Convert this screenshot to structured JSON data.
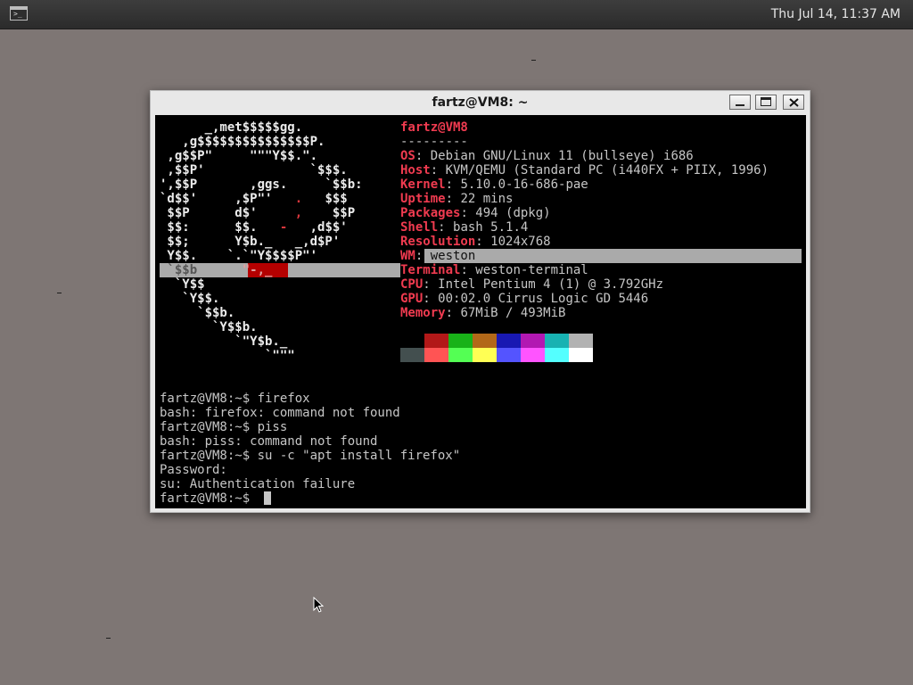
{
  "panel": {
    "clock": "Thu Jul 14, 11:37 AM",
    "launcher_icon": "terminal-icon"
  },
  "window": {
    "title": "fartz@VM8: ~",
    "buttons": [
      "minimize-icon",
      "maximize-icon",
      "close-icon"
    ]
  },
  "logo": {
    "lines": [
      "      _,met$$$$$gg.",
      "   ,g$$$$$$$$$$$$$$$P.",
      " ,g$$P\"     \"\"\"Y$$.\".",
      " ,$$P'              `$$$.",
      "',$$P       ,ggs.     `$$b:",
      "`d$$'     ,$P\"'   ",
      " $$P      d$'     ",
      " $$:      $$.   ",
      " $$;      Y$b._   _,d$P'",
      " Y$$.    `.`\"Y$$$$P\"'",
      " `$$b      ",
      "  `Y$$",
      "   `Y$$.",
      "     `$$b.",
      "       `Y$$b.",
      "          `\"Y$b._",
      "              `\"\"\""
    ],
    "swirl": [
      ".",
      ",",
      "-",
      "\"-,_"
    ],
    "line_tails": [
      "   $$$",
      "    $$P",
      ",d$$'"
    ]
  },
  "neofetch": {
    "user_host": "fartz@VM8",
    "separator": "---------",
    "fields": [
      {
        "key": "OS",
        "value": "Debian GNU/Linux 11 (bullseye) i686"
      },
      {
        "key": "Host",
        "value": "KVM/QEMU (Standard PC (i440FX + PIIX, 1996)"
      },
      {
        "key": "Kernel",
        "value": "5.10.0-16-686-pae"
      },
      {
        "key": "Uptime",
        "value": "22 mins"
      },
      {
        "key": "Packages",
        "value": "494 (dpkg)"
      },
      {
        "key": "Shell",
        "value": "bash 5.1.4"
      },
      {
        "key": "Resolution",
        "value": "1024x768"
      },
      {
        "key": "WM",
        "value": "weston"
      },
      {
        "key": "Terminal",
        "value": "weston-terminal"
      },
      {
        "key": "CPU",
        "value": "Intel Pentium 4 (1) @ 3.792GHz"
      },
      {
        "key": "GPU",
        "value": "00:02.0 Cirrus Logic GD 5446"
      },
      {
        "key": "Memory",
        "value": "67MiB / 493MiB"
      }
    ],
    "palette_top": [
      "#000000",
      "#b21818",
      "#18b218",
      "#b26818",
      "#1818b2",
      "#b218b2",
      "#18b2b2",
      "#b2b2b2"
    ],
    "palette_bottom": [
      "#434f4f",
      "#ff5454",
      "#54ff54",
      "#ffff54",
      "#5454ff",
      "#ff54ff",
      "#54ffff",
      "#ffffff"
    ]
  },
  "history": [
    "fartz@VM8:~$ firefox",
    "bash: firefox: command not found",
    "fartz@VM8:~$ piss",
    "bash: piss: command not found",
    "fartz@VM8:~$ su -c \"apt install firefox\"",
    "Password:",
    "su: Authentication failure",
    "fartz@VM8:~$ "
  ]
}
